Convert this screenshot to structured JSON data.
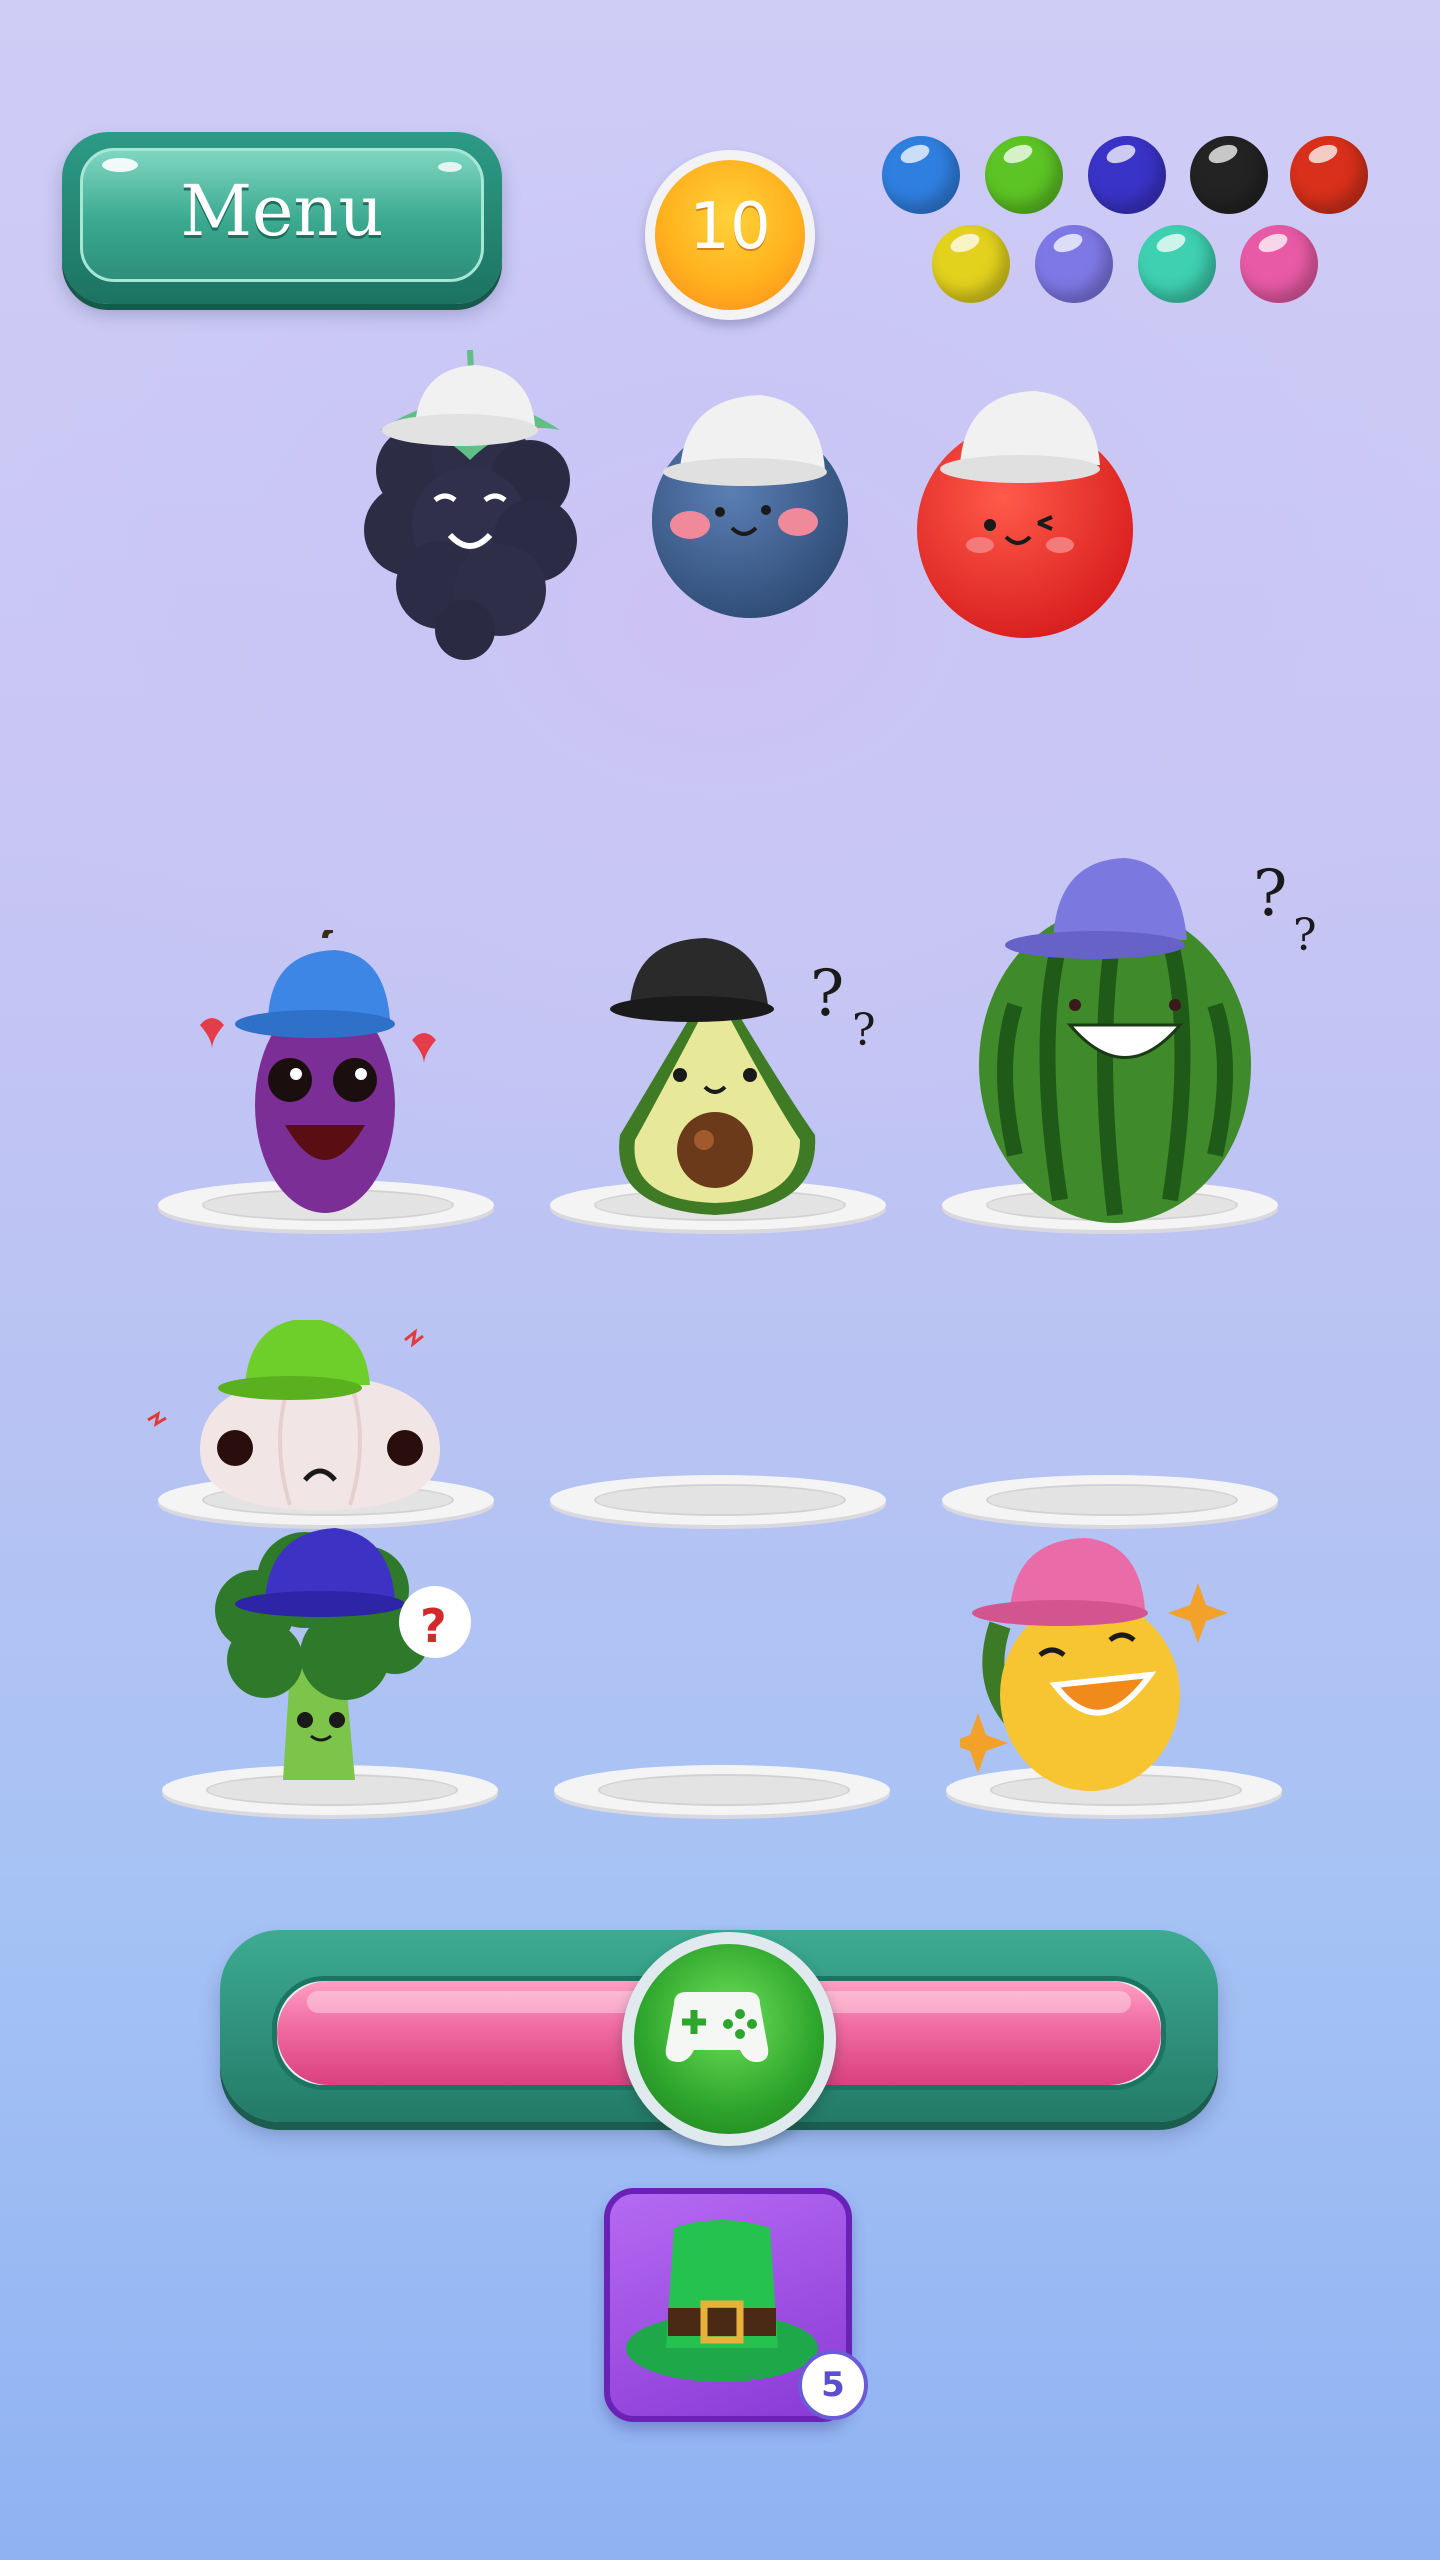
{
  "menu": {
    "label": "Menu"
  },
  "score": {
    "value": "10"
  },
  "palette": {
    "colors": [
      "#2f7fe0",
      "#5cc424",
      "#3a33c8",
      "#232323",
      "#d8301a",
      "#e2d21d",
      "#7e78e6",
      "#3ed0b0",
      "#e85aa6"
    ],
    "names": [
      "blue",
      "green",
      "indigo",
      "black",
      "red",
      "yellow",
      "lavender",
      "teal",
      "pink"
    ]
  },
  "top_row": [
    {
      "name": "blackberry",
      "cap_color": "#f2f2f2"
    },
    {
      "name": "blueberry",
      "cap_color": "#f2f2f2"
    },
    {
      "name": "tomato",
      "cap_color": "#f2f2f2"
    }
  ],
  "board": [
    {
      "character": "eggplant",
      "cap_color": "#3d86e6",
      "mood": "love"
    },
    {
      "character": "avocado",
      "cap_color": "#2a2a2a",
      "mood": "confused"
    },
    {
      "character": "watermelon",
      "cap_color": "#7b78e0",
      "mood": "confused"
    },
    {
      "character": "garlic",
      "cap_color": "#6fcf2a",
      "mood": "angry"
    },
    {
      "character": null
    },
    {
      "character": null
    },
    {
      "character": "broccoli",
      "cap_color": "#3d32c4",
      "mood": "question"
    },
    {
      "character": null
    },
    {
      "character": "lemon",
      "cap_color": "#e96ba8",
      "mood": "laughing"
    }
  ],
  "progress": {
    "fraction": 1.0
  },
  "powerup": {
    "item": "leprechaun-hat",
    "count": "5"
  }
}
